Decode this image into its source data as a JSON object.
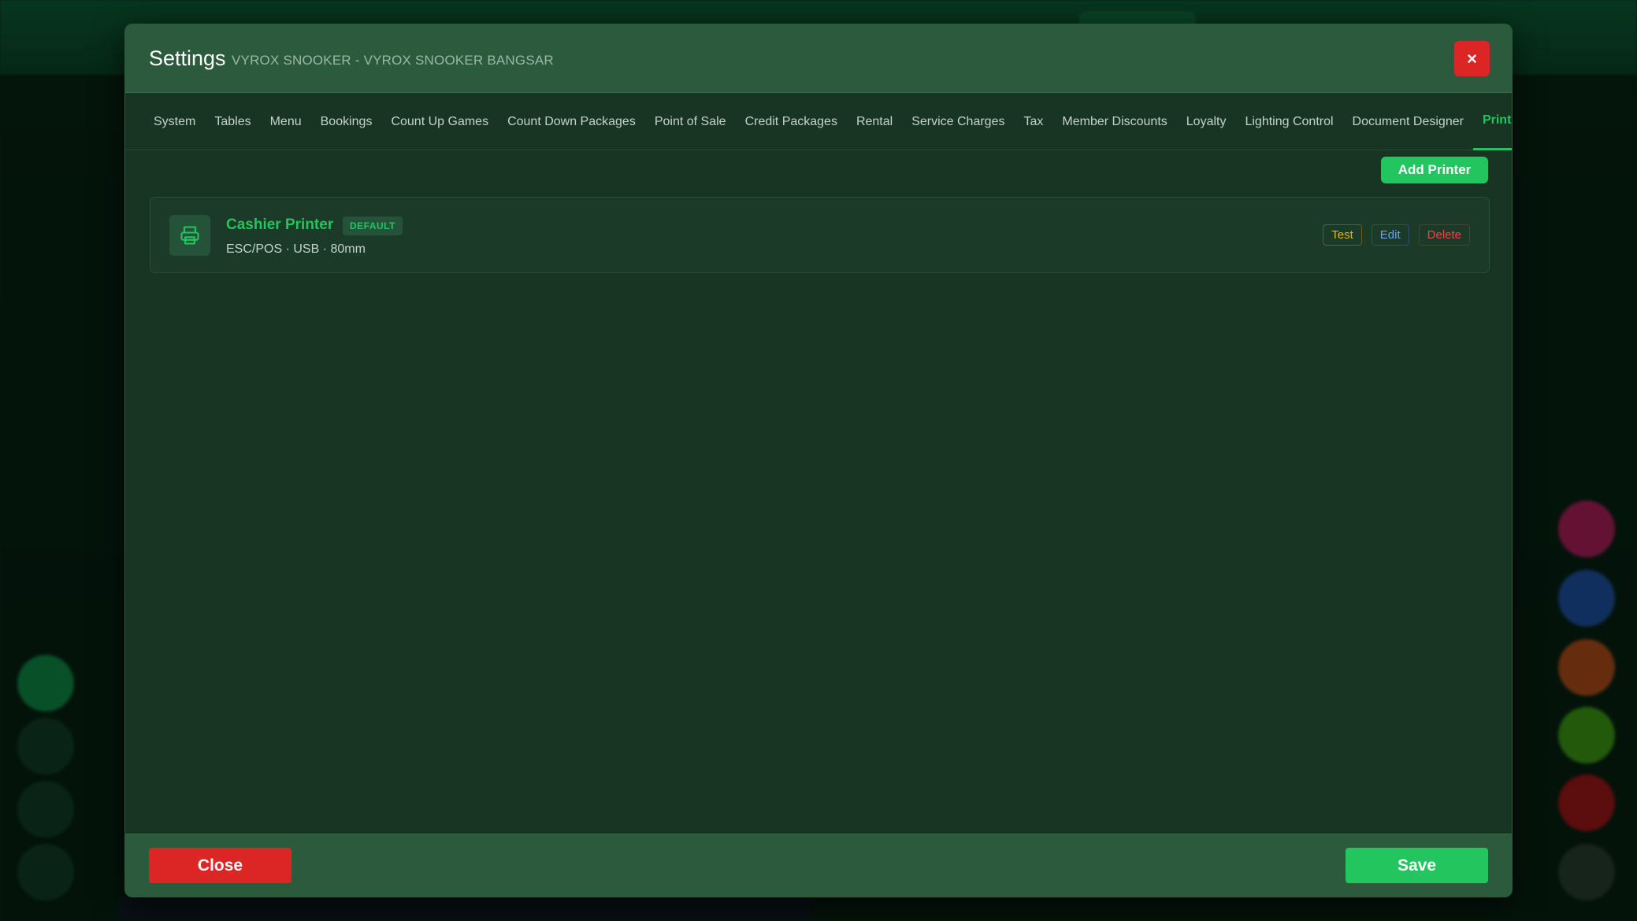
{
  "modal": {
    "title": "Settings",
    "subtitle": "VYROX SNOOKER - VYROX SNOOKER BANGSAR",
    "close_icon": "×"
  },
  "tabs": [
    {
      "label": "System",
      "active": false
    },
    {
      "label": "Tables",
      "active": false
    },
    {
      "label": "Menu",
      "active": false
    },
    {
      "label": "Bookings",
      "active": false
    },
    {
      "label": "Count Up Games",
      "active": false
    },
    {
      "label": "Count Down Packages",
      "active": false
    },
    {
      "label": "Point of Sale",
      "active": false
    },
    {
      "label": "Credit Packages",
      "active": false
    },
    {
      "label": "Rental",
      "active": false
    },
    {
      "label": "Service Charges",
      "active": false
    },
    {
      "label": "Tax",
      "active": false
    },
    {
      "label": "Member Discounts",
      "active": false
    },
    {
      "label": "Loyalty",
      "active": false
    },
    {
      "label": "Lighting Control",
      "active": false
    },
    {
      "label": "Document Designer",
      "active": false
    },
    {
      "label": "Printers",
      "active": true
    }
  ],
  "printers_panel": {
    "add_button": "Add Printer",
    "printers": [
      {
        "name": "Cashier Printer",
        "badge": "DEFAULT",
        "meta": "ESC/POS · USB · 80mm",
        "icon": "printer-icon",
        "actions": {
          "test": "Test",
          "edit": "Edit",
          "delete": "Delete"
        }
      }
    ]
  },
  "footer": {
    "close_label": "Close",
    "save_label": "Save"
  },
  "colors": {
    "accent": "#22c55e",
    "danger": "#dc2626",
    "modal_bg": "#183423",
    "header_bg": "#2b5a3d",
    "test": "#eab308",
    "edit": "#60a5fa",
    "delete": "#ef4444"
  }
}
